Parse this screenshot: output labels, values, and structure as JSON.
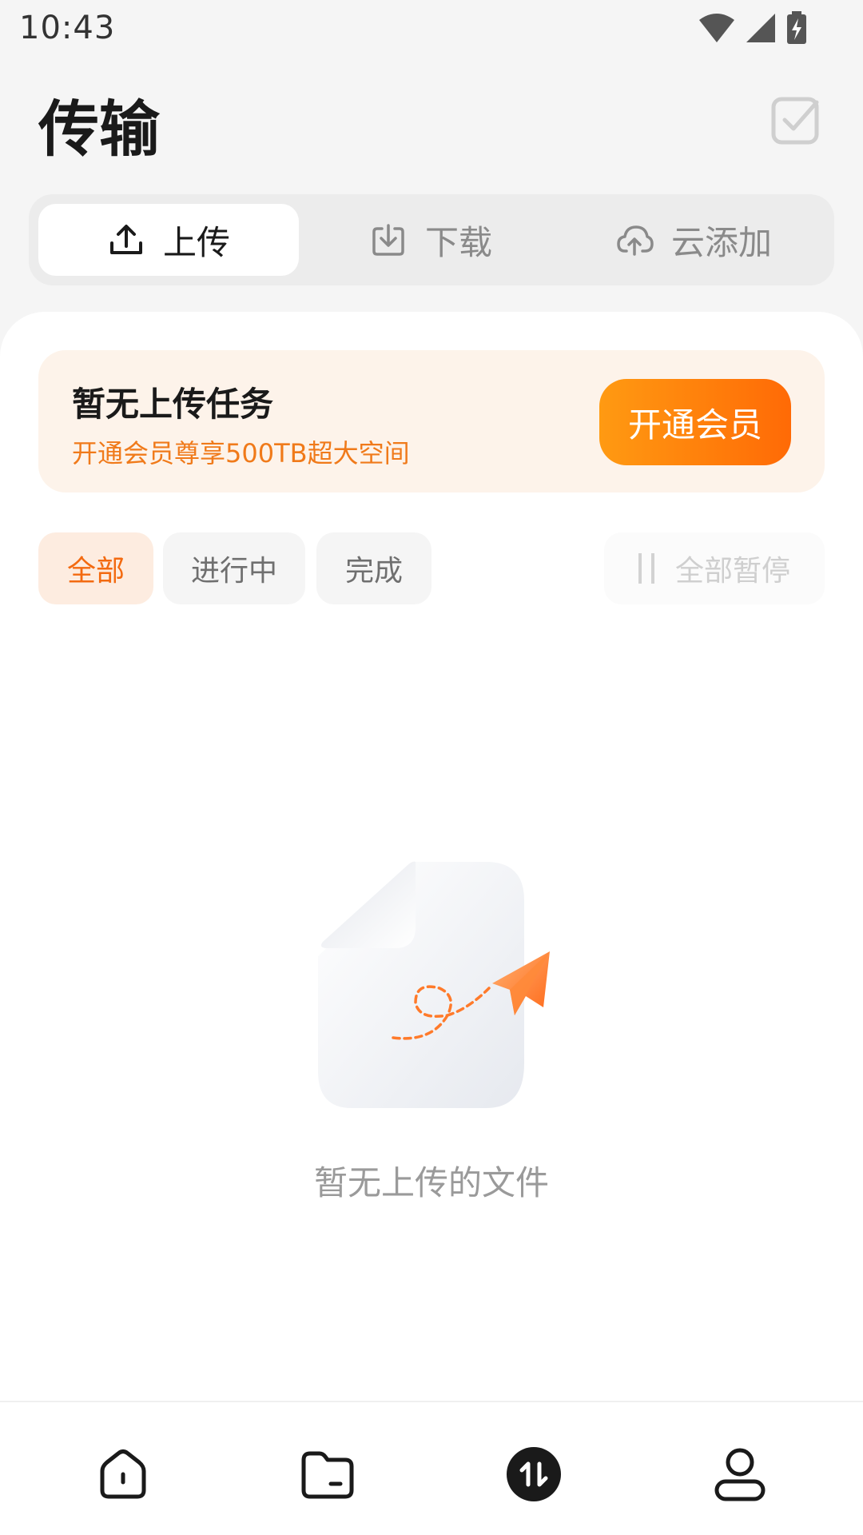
{
  "status_bar": {
    "time": "10:43"
  },
  "header": {
    "title": "传输"
  },
  "tabs": [
    {
      "label": "上传",
      "icon": "upload-icon",
      "active": true
    },
    {
      "label": "下载",
      "icon": "download-icon",
      "active": false
    },
    {
      "label": "云添加",
      "icon": "cloud-upload-icon",
      "active": false
    }
  ],
  "promo": {
    "title": "暂无上传任务",
    "subtitle": "开通会员尊享500TB超大空间",
    "button_label": "开通会员"
  },
  "filters": [
    {
      "label": "全部",
      "active": true
    },
    {
      "label": "进行中",
      "active": false
    },
    {
      "label": "完成",
      "active": false
    }
  ],
  "pause_all": {
    "label": "全部暂停",
    "enabled": false
  },
  "empty_state": {
    "message": "暂无上传的文件"
  },
  "bottom_nav": [
    {
      "icon": "home-icon",
      "active": false
    },
    {
      "icon": "folder-icon",
      "active": false
    },
    {
      "icon": "transfer-icon",
      "active": true
    },
    {
      "icon": "profile-icon",
      "active": false
    }
  ],
  "colors": {
    "accent": "#ff7a0a",
    "accent_text": "#f36a10",
    "promo_bg": "#fdf3ea"
  }
}
